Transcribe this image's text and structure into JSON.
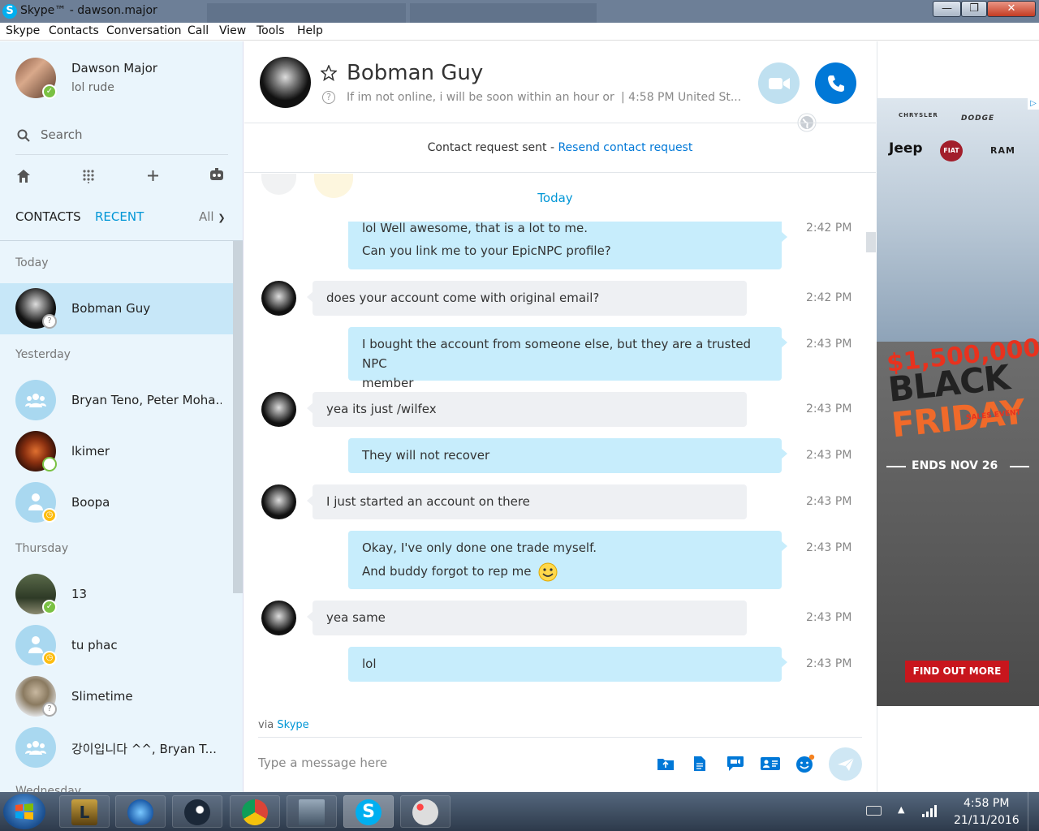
{
  "window": {
    "title": "Skype™ - dawson.major",
    "minimize": "—",
    "maximize": "❐",
    "close": "✕"
  },
  "menu": [
    "Skype",
    "Contacts",
    "Conversation",
    "Call",
    "View",
    "Tools",
    "Help"
  ],
  "profile": {
    "name": "Dawson Major",
    "mood": "lol rude"
  },
  "search": {
    "placeholder": "Search"
  },
  "tabs": {
    "contacts": "CONTACTS",
    "recent": "RECENT",
    "filter": "All"
  },
  "sections": {
    "today": "Today",
    "yesterday": "Yesterday",
    "thursday": "Thursday",
    "wednesday": "Wednesday"
  },
  "contacts": [
    {
      "name": "Bobman Guy",
      "status": "unknown"
    },
    {
      "name": "Bryan Teno, Peter Moha...",
      "status": "group"
    },
    {
      "name": "lkimer",
      "status": "offline"
    },
    {
      "name": "Boopa",
      "status": "away"
    },
    {
      "name": "13",
      "status": "online"
    },
    {
      "name": "tu phac",
      "status": "away"
    },
    {
      "name": "Slimetime",
      "status": "unknown"
    },
    {
      "name": "강이입니다 ^^, Bryan T...",
      "status": "group"
    }
  ],
  "chat": {
    "name": "Bobman Guy",
    "mood": "If im not online, i will be soon within an hour or...",
    "local_time": "| 4:58 PM United St...",
    "request_sent": "Contact request sent - ",
    "resend": "Resend contact request",
    "date_divider": "Today",
    "messages": [
      {
        "dir": "out",
        "lines": [
          "lol Well awesome, that is a lot to me.",
          "Can you link me to your EpicNPC profile?"
        ],
        "time": "2:42 PM"
      },
      {
        "dir": "in",
        "lines": [
          "does your account come with original email?"
        ],
        "time": "2:42 PM"
      },
      {
        "dir": "out",
        "lines": [
          "I bought the account from someone else, but they are a trusted NPC",
          "member"
        ],
        "time": "2:43 PM"
      },
      {
        "dir": "in",
        "lines": [
          "yea its just /wilfex"
        ],
        "time": "2:43 PM"
      },
      {
        "dir": "out",
        "lines": [
          "They will not recover"
        ],
        "time": "2:43 PM"
      },
      {
        "dir": "in",
        "lines": [
          "I just started an account on there"
        ],
        "time": "2:43 PM"
      },
      {
        "dir": "out",
        "lines": [
          "Okay, I've only done one trade myself.",
          "And buddy forgot to rep me"
        ],
        "time": "2:43 PM"
      },
      {
        "dir": "in",
        "lines": [
          "yea same"
        ],
        "time": "2:43 PM"
      },
      {
        "dir": "out",
        "lines": [
          "lol"
        ],
        "time": "2:43 PM"
      }
    ],
    "via": "via ",
    "via_link": "Skype",
    "input_placeholder": "Type a message here"
  },
  "ad": {
    "brands": [
      "CHRYSLER",
      "DODGE",
      "Jeep",
      "FIAT",
      "RAM"
    ],
    "headline": "$1,500,000",
    "big1": "BLACK",
    "big2": "FRIDAY",
    "sub": "SALES EVENT",
    "ends": "ENDS NOV 26",
    "cta": "FIND OUT MORE"
  },
  "taskbar": {
    "time": "4:58 PM",
    "date": "21/11/2016"
  },
  "colors": {
    "accent": "#0078d7",
    "link": "#0096d6",
    "sidebar": "#eaf5fc",
    "out_bubble": "#c7edfc",
    "in_bubble": "#eef0f3"
  },
  "icons": [
    "home-icon",
    "dialpad-icon",
    "add-icon",
    "bot-icon",
    "search-icon",
    "video-call-icon",
    "audio-call-icon",
    "globe-icon",
    "star-icon",
    "help-icon",
    "send-file-icon",
    "document-icon",
    "video-message-icon",
    "contact-card-icon",
    "emoticon-icon",
    "send-icon"
  ]
}
